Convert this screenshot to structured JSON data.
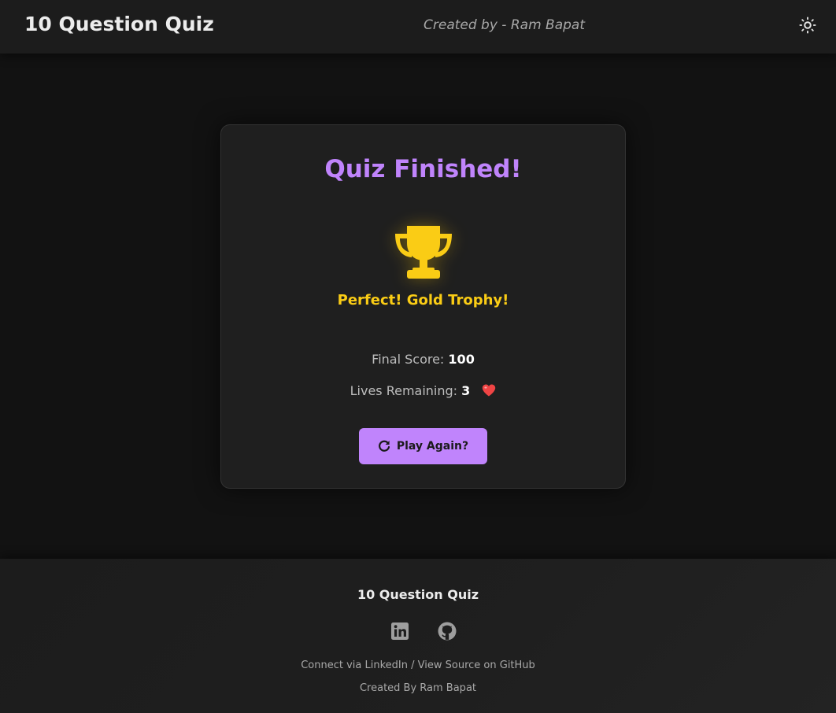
{
  "header": {
    "title": "10 Question Quiz",
    "credit": "Created by - Ram Bapat",
    "theme_icon": "sun-icon"
  },
  "result": {
    "title": "Quiz Finished!",
    "trophy_icon": "trophy-icon",
    "trophy_text": "Perfect! Gold Trophy!",
    "score_label": "Final Score:",
    "score_value": "100",
    "lives_label": "Lives Remaining:",
    "lives_value": "3",
    "heart_icon": "heart-icon",
    "play_again_label": "Play Again?",
    "play_again_icon": "rotate-right-icon"
  },
  "footer": {
    "title": "10 Question Quiz",
    "icons": [
      "linkedin-icon",
      "github-icon"
    ],
    "link_linkedin": "Connect via LinkedIn",
    "separator": "/",
    "link_github": "View Source on GitHub",
    "credit": "Created By Ram Bapat"
  },
  "colors": {
    "accent": "#c084fc",
    "gold": "#facc15",
    "background": "#121212",
    "card": "#1f1f1f",
    "heart": "#ef4444"
  }
}
